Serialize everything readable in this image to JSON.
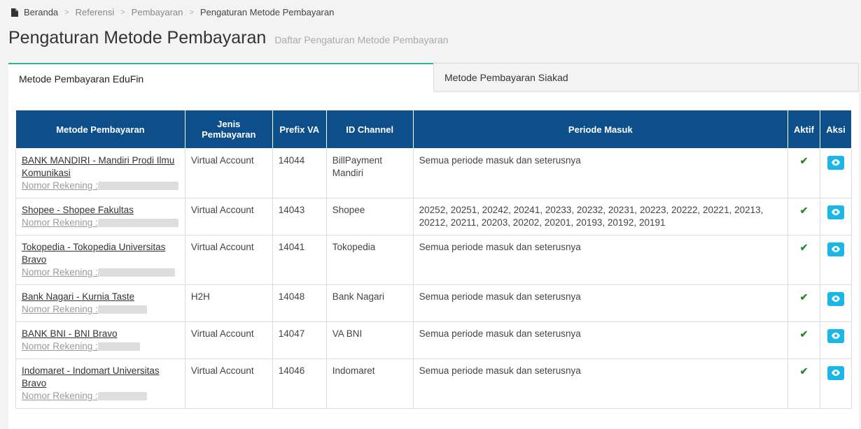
{
  "breadcrumb": {
    "home": "Beranda",
    "items": [
      "Referensi",
      "Pembayaran"
    ],
    "current": "Pengaturan Metode Pembayaran"
  },
  "page": {
    "title": "Pengaturan Metode Pembayaran",
    "subtitle": "Daftar Pengaturan Metode Pembayaran"
  },
  "tabs": {
    "edufin": "Metode Pembayaran EduFin",
    "siakad": "Metode Pembayaran Siakad"
  },
  "table": {
    "headers": {
      "metode": "Metode Pembayaran",
      "jenis": "Jenis Pembayaran",
      "prefix": "Prefix VA",
      "channel": "ID Channel",
      "periode": "Periode Masuk",
      "aktif": "Aktif",
      "aksi": "Aksi"
    },
    "rekening_label": "Nomor Rekening :",
    "rows": [
      {
        "metode": "BANK MANDIRI - Mandiri Prodi Ilmu Komunikasi",
        "jenis": "Virtual Account",
        "prefix": "14044",
        "channel": "BillPayment Mandiri",
        "periode": "Semua periode masuk dan seterusnya"
      },
      {
        "metode": "Shopee - Shopee Fakultas",
        "jenis": "Virtual Account",
        "prefix": "14043",
        "channel": "Shopee",
        "periode": "20252, 20251, 20242, 20241, 20233, 20232, 20231, 20223, 20222, 20221, 20213, 20212, 20211, 20203, 20202, 20201, 20193, 20192, 20191"
      },
      {
        "metode": "Tokopedia - Tokopedia Universitas Bravo",
        "jenis": "Virtual Account",
        "prefix": "14041",
        "channel": "Tokopedia",
        "periode": "Semua periode masuk dan seterusnya"
      },
      {
        "metode": "Bank Nagari - Kurnia Taste",
        "jenis": "H2H",
        "prefix": "14048",
        "channel": "Bank Nagari",
        "periode": "Semua periode masuk dan seterusnya"
      },
      {
        "metode": "BANK BNI - BNI Bravo",
        "jenis": "Virtual Account",
        "prefix": "14047",
        "channel": "VA BNI",
        "periode": "Semua periode masuk dan seterusnya"
      },
      {
        "metode": "Indomaret - Indomart Universitas Bravo",
        "jenis": "Virtual Account",
        "prefix": "14046",
        "channel": "Indomaret",
        "periode": "Semua periode masuk dan seterusnya"
      }
    ]
  },
  "colors": {
    "header_bg": "#0d4f8b",
    "tab_accent": "#2bb3a0",
    "eye_button": "#1ab6e8",
    "check": "#2a8a2a"
  }
}
